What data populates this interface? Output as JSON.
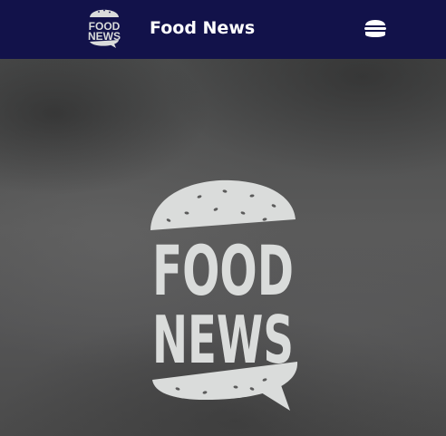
{
  "header": {
    "logo_text_line1": "FOOD",
    "logo_text_line2": "NEWS",
    "title": "Food News",
    "menu_icon": "hamburger-icon"
  },
  "hero": {
    "logo_text_line1": "FOOD",
    "logo_text_line2": "NEWS",
    "logo_icon": "burger-logo"
  },
  "colors": {
    "header_bg": "#12124a",
    "logo_fill": "#dadcdb",
    "title_color": "#ffffff"
  }
}
